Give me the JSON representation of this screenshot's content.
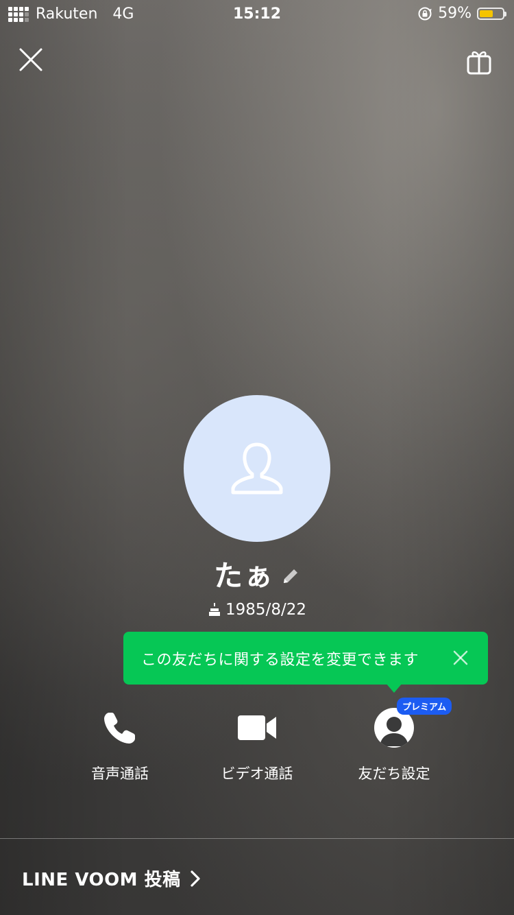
{
  "status_bar": {
    "carrier": "Rakuten",
    "network": "4G",
    "time": "15:12",
    "battery_percent": "59%",
    "battery_level": 0.59,
    "battery_color": "#f5c400"
  },
  "header": {
    "close_icon": "close-icon",
    "gift_icon": "gift-icon"
  },
  "profile": {
    "name": "たぁ",
    "birthday": "1985/8/22",
    "avatar_bg": "#d9e6fb"
  },
  "tooltip": {
    "text": "この友だちに関する設定を変更できます",
    "color": "#06c755"
  },
  "actions": {
    "voice_call": "音声通話",
    "video_call": "ビデオ通話",
    "friend_settings": "友だち設定",
    "premium_badge": "プレミアム"
  },
  "footer": {
    "voom_link": "LINE VOOM 投稿"
  }
}
